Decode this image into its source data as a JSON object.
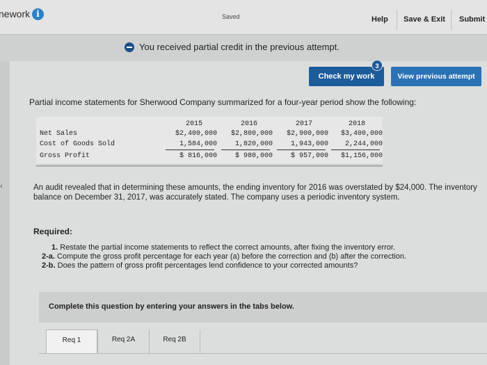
{
  "header": {
    "title": "nework",
    "saved": "Saved",
    "help": "Help",
    "save_exit": "Save & Exit",
    "submit": "Submit"
  },
  "notice": {
    "message": "You received partial credit in the previous attempt."
  },
  "actions": {
    "check": "Check my work",
    "check_badge": "3",
    "view_previous": "View previous attempt"
  },
  "intro": "Partial income statements for Sherwood Company summarized for a four-year period show the following:",
  "table": {
    "years": [
      "2015",
      "2016",
      "2017",
      "2018"
    ],
    "rows": [
      {
        "label": "Net Sales",
        "values": [
          "$2,400,000",
          "$2,800,000",
          "$2,900,000",
          "$3,400,000"
        ]
      },
      {
        "label": "Cost of Goods Sold",
        "values": [
          "1,584,000",
          "1,820,000",
          "1,943,000",
          "2,244,000"
        ]
      },
      {
        "label": "Gross Profit",
        "values": [
          "$ 816,000",
          "$ 980,000",
          "$ 957,000",
          "$1,156,000"
        ]
      }
    ]
  },
  "audit": "An audit revealed that in determining these amounts, the ending inventory for 2016 was overstated by $24,000. The inventory balance on December 31, 2017, was accurately stated. The company uses a periodic inventory system.",
  "required": {
    "heading": "Required:",
    "items": [
      {
        "num": "1.",
        "text": "Restate the partial income statements to reflect the correct amounts, after fixing the inventory error."
      },
      {
        "num": "2-a.",
        "text": "Compute the gross profit percentage for each year (a) before the correction and (b) after the correction."
      },
      {
        "num": "2-b.",
        "text": "Does the pattern of gross profit percentages lend confidence to your corrected amounts?"
      }
    ]
  },
  "complete_instruction": "Complete this question by entering your answers in the tabs below.",
  "tabs": [
    "Req 1",
    "Req 2A",
    "Req 2B"
  ],
  "colors": {
    "primary_button": "#1d5c9b",
    "info_icon": "#2a82c9"
  },
  "icons": {
    "info": "info-icon",
    "notice": "minus-circle-icon",
    "collapse": "chevron-left-icon"
  }
}
